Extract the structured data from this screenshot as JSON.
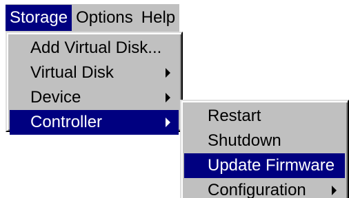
{
  "menubar": {
    "items": [
      {
        "label": "Storage",
        "active": true
      },
      {
        "label": "Options",
        "active": false
      },
      {
        "label": "Help",
        "active": false
      }
    ]
  },
  "storage_menu": {
    "items": [
      {
        "label": "Add Virtual Disk...",
        "has_submenu": false
      },
      {
        "label": "Virtual Disk",
        "has_submenu": true
      },
      {
        "label": "Device",
        "has_submenu": true
      },
      {
        "label": "Controller",
        "has_submenu": true,
        "highlighted": true
      }
    ]
  },
  "controller_submenu": {
    "items": [
      {
        "label": "Restart",
        "has_submenu": false
      },
      {
        "label": "Shutdown",
        "has_submenu": false
      },
      {
        "label": "Update Firmware",
        "has_submenu": false,
        "highlighted": true
      },
      {
        "label": "Configuration",
        "has_submenu": true
      }
    ]
  },
  "colors": {
    "menu_face": "#c0c0c0",
    "highlight": "#000080",
    "highlight_text": "#ffffff"
  }
}
